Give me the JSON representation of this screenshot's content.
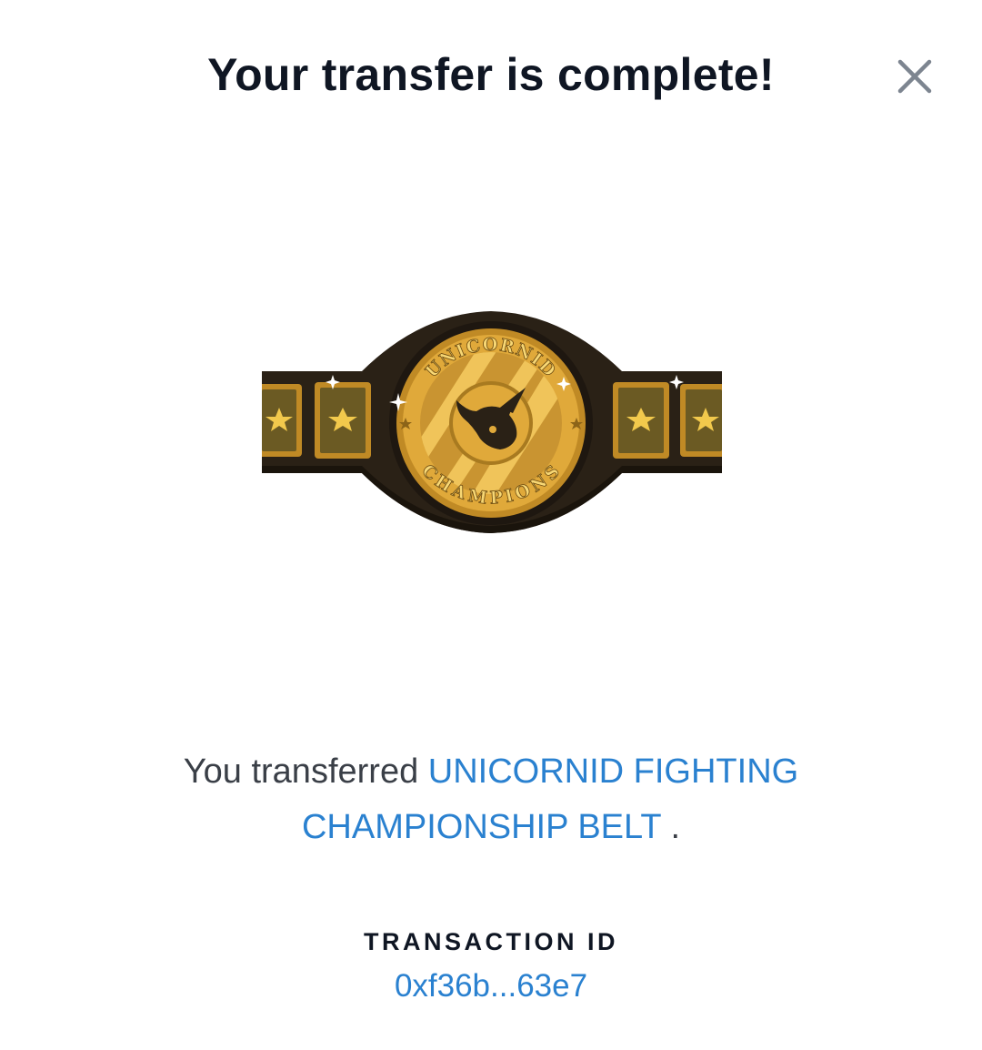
{
  "modal": {
    "title": "Your transfer is complete!",
    "close_icon": "close-icon"
  },
  "item": {
    "image_icon": "championship-belt-image",
    "belt_top_text": "UNICORNID",
    "belt_bottom_text": "CHAMPIONS"
  },
  "message": {
    "prefix": "You transferred",
    "item_name": "UNICORNID FIGHTING CHAMPIONSHIP BELT",
    "suffix": "."
  },
  "transaction": {
    "label": "TRANSACTION ID",
    "id": "0xf36b...63e7"
  },
  "colors": {
    "title": "#0f1623",
    "link": "#2a81d0",
    "text": "#3a3f47",
    "close_icon": "#7d8590",
    "gold": "#e0a93a",
    "belt_dark": "#2a2116"
  }
}
